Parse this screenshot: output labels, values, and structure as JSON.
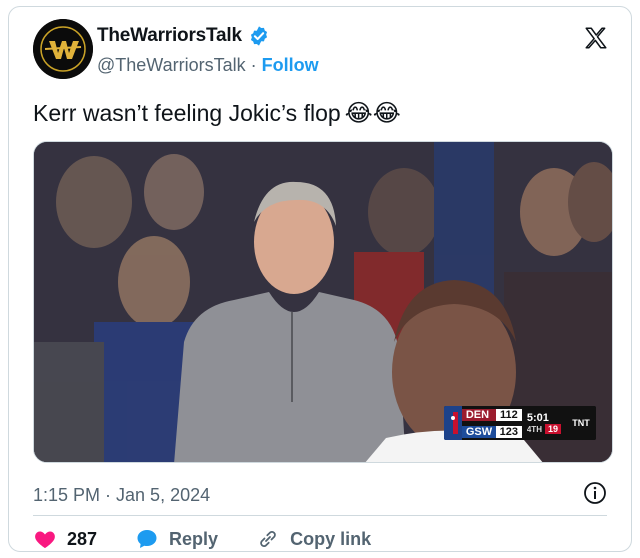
{
  "account": {
    "name": "TheWarriorsTalk",
    "handle": "@TheWarriorsTalk",
    "separator": "·",
    "follow_label": "Follow"
  },
  "tweet": {
    "text": "Kerr wasn’t feeling Jokic’s flop",
    "emojis": "😂😂"
  },
  "scorebug": {
    "away_team": "DEN",
    "away_score": "112",
    "home_team": "GSW",
    "home_score": "123",
    "clock": "5:01",
    "quarter": "4TH",
    "shot_clock": "19",
    "network": "TNT"
  },
  "meta": {
    "timestamp": "1:15 PM · Jan 5, 2024"
  },
  "actions": {
    "like_count": "287",
    "reply_label": "Reply",
    "copy_label": "Copy link"
  },
  "colors": {
    "accent": "#1d9bf0",
    "like": "#f91880",
    "muted": "#536471"
  },
  "icons": [
    "verified-icon",
    "x-logo-icon",
    "info-icon",
    "heart-icon",
    "reply-icon",
    "link-icon"
  ]
}
